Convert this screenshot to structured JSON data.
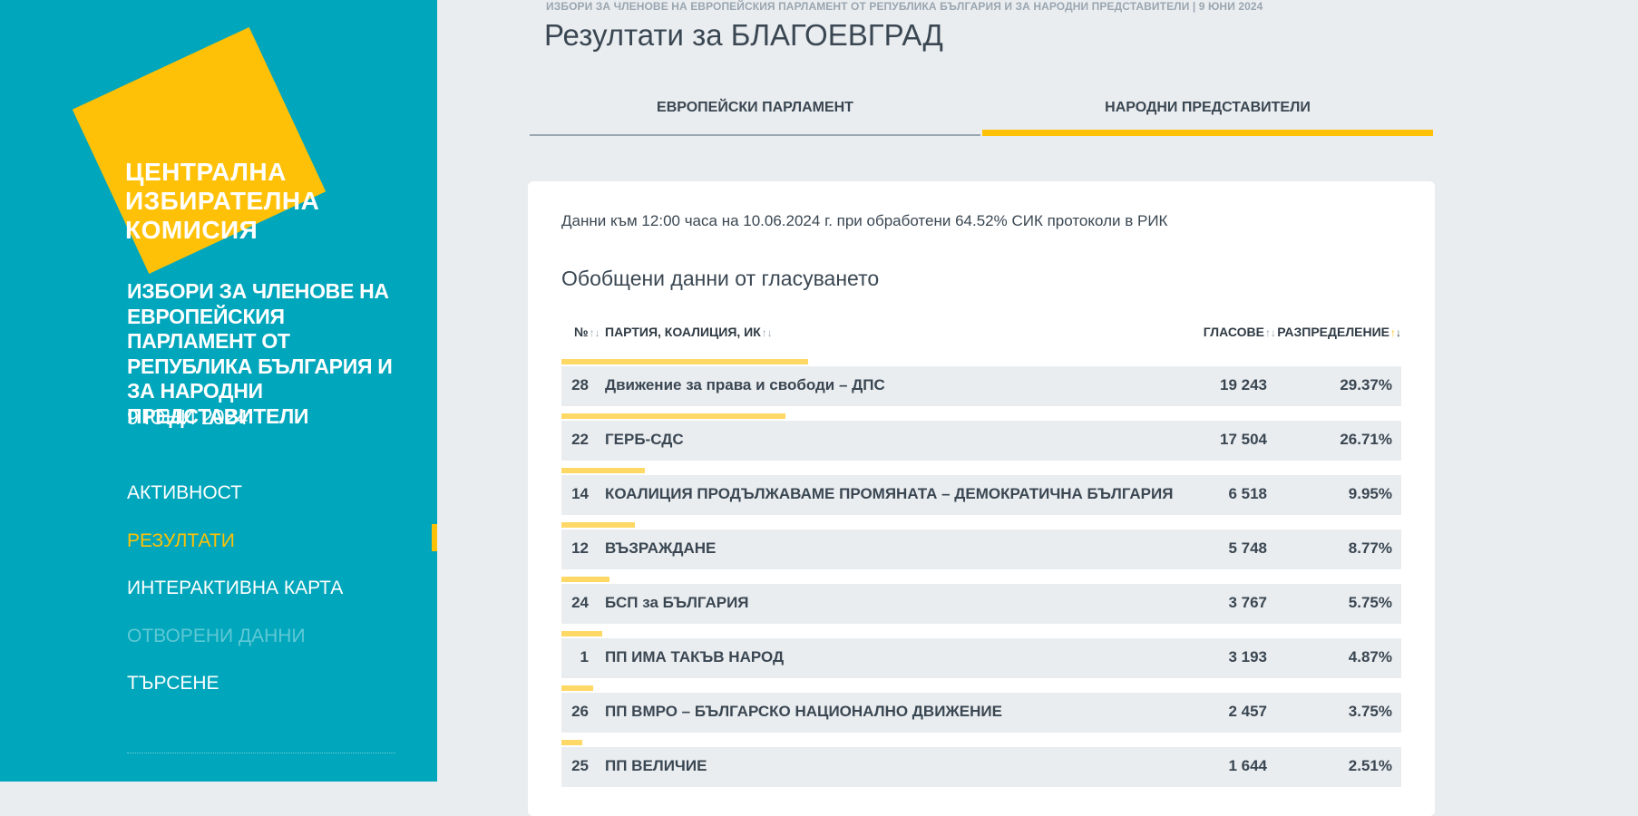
{
  "logo": {
    "line1": "ЦЕНТРАЛНА",
    "line2": "ИЗБИРАТЕЛНА",
    "line3": "КОМИСИЯ"
  },
  "sidebar": {
    "election_title": "ИЗБОРИ ЗА ЧЛЕНОВЕ НА ЕВРОПЕЙСКИЯ ПАРЛАМЕНТ ОТ РЕПУБЛИКА БЪЛГАРИЯ И ЗА НАРОДНИ ПРЕДСТАВИТЕЛИ",
    "election_date": "9 ЮНИ 2024",
    "nav": [
      "АКТИВНОСТ",
      "РЕЗУЛТАТИ",
      "ИНТЕРАКТИВНА КАРТА",
      "ОТВОРЕНИ ДАННИ",
      "ТЪРСЕНЕ"
    ],
    "active_index": 1
  },
  "header": {
    "caption": "ИЗБОРИ ЗА ЧЛЕНОВЕ НА ЕВРОПЕЙСКИЯ ПАРЛАМЕНТ ОТ РЕПУБЛИКА БЪЛГАРИЯ И ЗА НАРОДНИ ПРЕДСТАВИТЕЛИ | 9 ЮНИ 2024",
    "title": "Резултати за БЛАГОЕВГРАД"
  },
  "tabs": {
    "european": "ЕВРОПЕЙСКИ ПАРЛАМЕНТ",
    "national": "НАРОДНИ ПРЕДСТАВИТЕЛИ",
    "active": "national"
  },
  "results": {
    "note": "Данни към 12:00 часа на 10.06.2024 г. при обработени 64.52% СИК протоколи в РИК",
    "section_title": "Обобщени данни от гласуването",
    "columns": {
      "num": "№",
      "party": "ПАРТИЯ, КОАЛИЦИЯ, ИК",
      "votes": "ГЛАСОВЕ",
      "share": "РАЗПРЕДЕЛЕНИЕ"
    },
    "rows": [
      {
        "num": "28",
        "party": "Движение за права и свободи – ДПС",
        "votes": "19 243",
        "share": "29.37%",
        "share_value": 29.37
      },
      {
        "num": "22",
        "party": "ГЕРБ-СДС",
        "votes": "17 504",
        "share": "26.71%",
        "share_value": 26.71
      },
      {
        "num": "14",
        "party": "КОАЛИЦИЯ ПРОДЪЛЖАВАМЕ ПРОМЯНАТА – ДЕМОКРАТИЧНА БЪЛГАРИЯ",
        "votes": "6 518",
        "share": "9.95%",
        "share_value": 9.95
      },
      {
        "num": "12",
        "party": "ВЪЗРАЖДАНЕ",
        "votes": "5 748",
        "share": "8.77%",
        "share_value": 8.77
      },
      {
        "num": "24",
        "party": "БСП за БЪЛГАРИЯ",
        "votes": "3 767",
        "share": "5.75%",
        "share_value": 5.75
      },
      {
        "num": "1",
        "party": "ПП ИМА ТАКЪВ НАРОД",
        "votes": "3 193",
        "share": "4.87%",
        "share_value": 4.87
      },
      {
        "num": "26",
        "party": "ПП ВМРО – БЪЛГАРСКО НАЦИОНАЛНО ДВИЖЕНИЕ",
        "votes": "2 457",
        "share": "3.75%",
        "share_value": 3.75
      },
      {
        "num": "25",
        "party": "ПП ВЕЛИЧИЕ",
        "votes": "1 644",
        "share": "2.51%",
        "share_value": 2.51
      }
    ]
  },
  "colors": {
    "sidebar": "#00a6bb",
    "accent": "#ffc107",
    "bar": "#ffd866",
    "background": "#eaedf0"
  }
}
